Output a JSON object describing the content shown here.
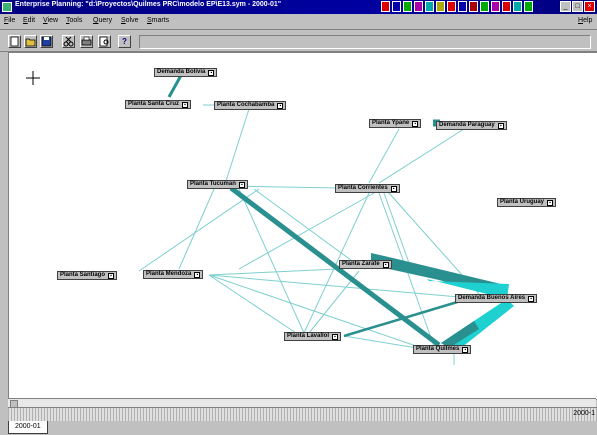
{
  "window": {
    "title": "Enterprise Planning: \"d:\\Proyectos\\Quilmes PRC\\modelo EP\\E13.sym - 2000-01\"",
    "icon": "app-icon",
    "controls": [
      "minimize-icon",
      "maximize-icon",
      "close-icon"
    ]
  },
  "menu": {
    "file": "File",
    "edit": "Edit",
    "view": "View",
    "tools": "Tools",
    "query": "Query",
    "solve": "Solve",
    "smarts": "Smarts",
    "help": "Help"
  },
  "toolbar": {
    "buttons": [
      "new-icon",
      "open-icon",
      "save-icon",
      "cut-icon",
      "print-icon",
      "preview-icon",
      "help-icon"
    ],
    "help_glyph": "?"
  },
  "colors": {
    "flow_light": "#7fcfcf",
    "flow_dark": "#2a8f8f",
    "flow_bright": "#1fd0d0",
    "node_bg": "#c0c0c0"
  },
  "nodes": {
    "demanda_bolivia": "Demanda Bolivia",
    "planta_santa_cruz": "Planta Santa Cruz",
    "planta_cochabamba": "Planta Cochabamba",
    "planta_ypane": "Planta Ypane",
    "demanda_paraguay": "Demanda Paraguay",
    "planta_tucuman": "Planta Tucuman",
    "planta_corrientes": "Planta Corrientes",
    "planta_uruguay": "Planta Uruguay",
    "planta_santiago": "Planta Santiago",
    "planta_mendoza": "Planta Mendoza",
    "planta_zarate": "Planta Zarate",
    "demanda_buenos_aires": "Demanda Buenos Aires",
    "planta_lavallol": "Planta Lavallol",
    "planta_quilmes": "Planta Quilmes"
  },
  "timeline": {
    "end_label": "2000-1"
  },
  "tabs": {
    "period": "2000-01"
  }
}
